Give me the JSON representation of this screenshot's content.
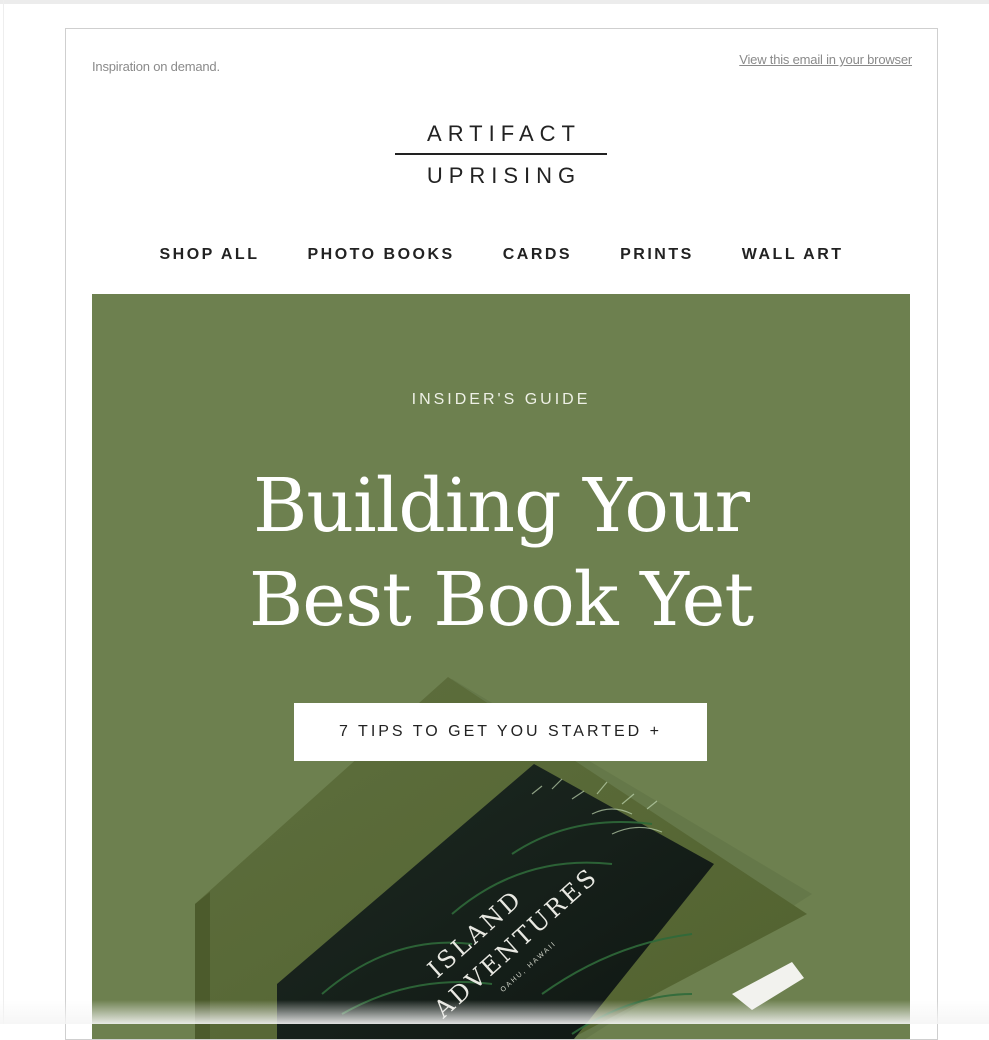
{
  "email": {
    "preheader": "Inspiration on demand.",
    "view_in_browser": "View this email in your browser",
    "logo": {
      "line1": "ARTIFACT",
      "line2": "UPRISING"
    },
    "nav": [
      "SHOP ALL",
      "PHOTO BOOKS",
      "CARDS",
      "PRINTS",
      "WALL ART"
    ],
    "hero": {
      "eyebrow": "INSIDER'S GUIDE",
      "headline_line1": "Building Your",
      "headline_line2": "Best Book Yet",
      "cta": "7 TIPS TO GET YOU STARTED +",
      "book_title_line1": "ISLAND",
      "book_title_line2": "ADVENTURES",
      "book_subtitle": "OAHU, HAWAII",
      "bg_color": "#6d804f"
    }
  }
}
